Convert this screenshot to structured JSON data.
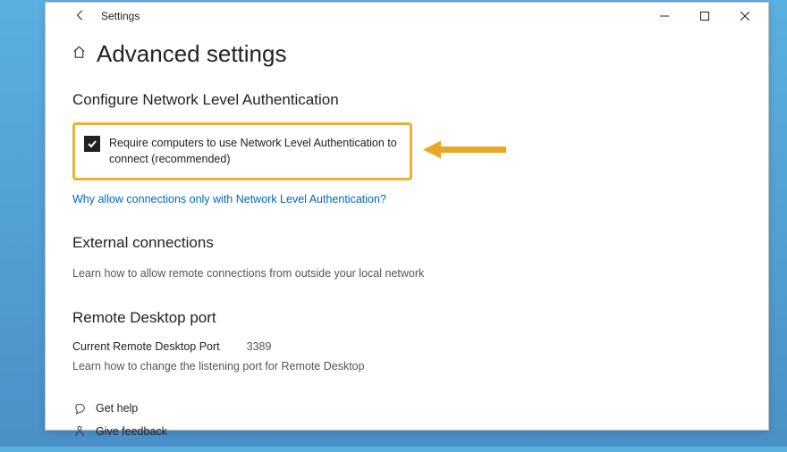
{
  "window": {
    "title": "Settings"
  },
  "page": {
    "title": "Advanced settings"
  },
  "nla": {
    "heading": "Configure Network Level Authentication",
    "checkbox_label": "Require computers to use Network Level Authentication to connect (recommended)",
    "help_link": "Why allow connections only with Network Level Authentication?"
  },
  "external": {
    "heading": "External connections",
    "text": "Learn how to allow remote connections from outside your local network"
  },
  "port": {
    "heading": "Remote Desktop port",
    "label": "Current Remote Desktop Port",
    "value": "3389",
    "text": "Learn how to change the listening port for Remote Desktop"
  },
  "footer": {
    "help": "Get help",
    "feedback": "Give feedback"
  }
}
